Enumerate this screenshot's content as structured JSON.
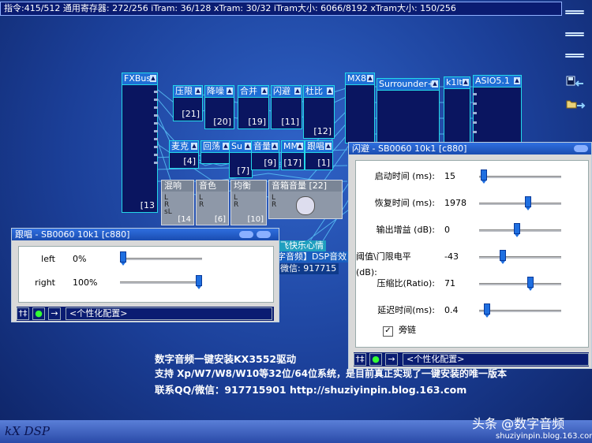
{
  "status_bar": "指令:415/512 通用寄存器: 272/256 iTram: 36/128 xTram: 30/32 iTram大小: 6066/8192 xTram大小: 150/256",
  "modules": {
    "fxbus": "FXBus",
    "fxbus_num": "[13",
    "yaxian": "压限",
    "yaxian_num": "[21]",
    "jianghao": "降噪",
    "jianghao_num": "[20]",
    "hebing": "合并",
    "hebing_num": "[19]",
    "shanbi": "闪避",
    "shanbi_num": "[11]",
    "dubi": "杜比",
    "dubi_num": "[12]",
    "mx8": "MX8",
    "surrounder": "Surrounder+",
    "k1lt": "k1lt",
    "asio": "ASIO5.1",
    "maike": "麦克",
    "maike_num": "[4]",
    "huidang": "回荡",
    "su": "Su",
    "su_num": "[7]",
    "yinliang": "音量",
    "yinliang_num": "[9]",
    "mm": "MM",
    "mm_num": "[17]",
    "genchang": "跟唱",
    "genchang_num": "[1]",
    "hunxiang": "混响",
    "hunxiang_num": "[14",
    "yinse": "音色",
    "yinse_num": "[6]",
    "junheng": "均衡",
    "junheng_num": "[10]",
    "yinxiang": "音箱音量 [22]",
    "lr_l": "L",
    "lr_r": "R",
    "sl": "sL"
  },
  "bg_text": {
    "fly": "飞快乐心情",
    "dsp": "字音频】DSP音效",
    "wechat": "微信: 917715"
  },
  "win_genchang": {
    "title": "跟唱 - SB0060 10k1 [c880]",
    "params": [
      {
        "label": "left",
        "value": "0%",
        "level": 0.0
      },
      {
        "label": "right",
        "value": "100%",
        "level": 1.0
      }
    ],
    "preset": "<个性化配置>"
  },
  "win_shanbi": {
    "title": "闪避 - SB0060 10k1 [c880]",
    "params": [
      {
        "label": "启动时间 (ms):",
        "value": "15",
        "level": 0.02
      },
      {
        "label": "恢复时间 (ms):",
        "value": "1978",
        "level": 0.6
      },
      {
        "label": "输出增益 (dB):",
        "value": "0",
        "level": 0.46
      },
      {
        "label": "阈值\\门限电平 (dB):",
        "value": "-43",
        "level": 0.27
      },
      {
        "label": "压缩比(Ratio):",
        "value": "71",
        "level": 0.64
      },
      {
        "label": "延迟时间(ms):",
        "value": "0.4",
        "level": 0.06
      }
    ],
    "checkbox_label": "旁链",
    "checkbox_checked": true,
    "preset": "<个性化配置>"
  },
  "footer_icons": {
    "tune": "†‡",
    "record": "●",
    "next": "→"
  },
  "promo": {
    "line1": "数字音频一键安装KX3552驱动",
    "line2": "支持 Xp/W7/W8/W10等32位/64位系统，是目前真正实现了一键安装的唯一版本",
    "line3": "联系QQ/微信：917715901   http://shuziyinpin.blog.163.com"
  },
  "logo": "kX DSP",
  "watermark": "头条 @数字音频",
  "watermark_url": "shuziyinpin.blog.163.com"
}
